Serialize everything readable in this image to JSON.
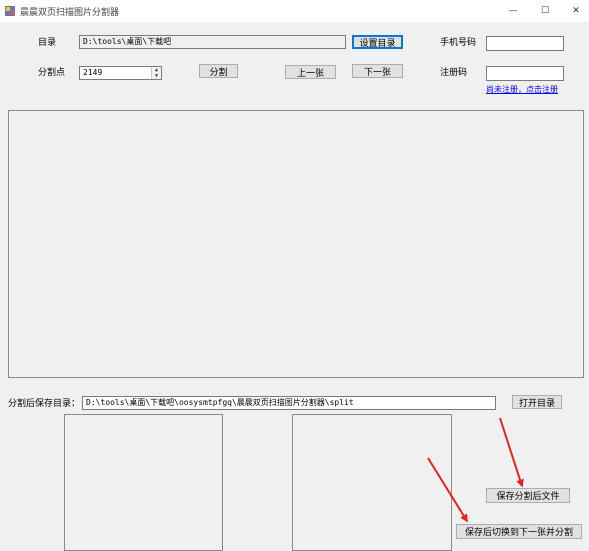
{
  "window": {
    "title": "晨晨双页扫描图片分割器",
    "minimize_glyph": "—",
    "maximize_glyph": "☐",
    "close_glyph": "✕",
    "app_icon": "app-icon"
  },
  "top": {
    "dir_label": "目录",
    "dir_value": "D:\\tools\\桌面\\下载吧",
    "set_dir_button": "设置目录",
    "split_point_label": "分割点",
    "split_point_value": "2149",
    "split_button": "分割",
    "prev_button": "上一张",
    "next_button": "下一张"
  },
  "registration": {
    "phone_label": "手机号码",
    "phone_value": "",
    "code_label": "注册码",
    "code_value": "",
    "register_link": "尚未注册，点击注册"
  },
  "bottom": {
    "save_dir_label": "分割后保存目录：",
    "save_dir_value": "D:\\tools\\桌面\\下载吧\\oosysmtpfgq\\晨晨双页扫描图片分割器\\split",
    "open_dir_button": "打开目录",
    "save_split_button": "保存分割后文件",
    "save_next_button": "保存后切换到下一张并分割"
  },
  "annotations": {
    "arrow_color": "#e02424"
  }
}
